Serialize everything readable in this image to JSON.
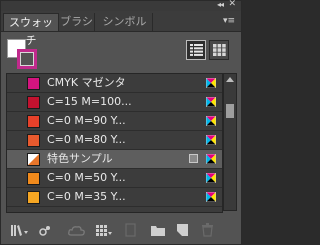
{
  "header": {
    "collapse_glyph": "◂◂",
    "close_glyph": "✕"
  },
  "tabs": [
    {
      "label": "スウォッチ",
      "active": true
    },
    {
      "label": "ブラシ",
      "active": false
    },
    {
      "label": "シンボル",
      "active": false
    }
  ],
  "panel_menu_glyph": "▾≡",
  "fill_stroke": {
    "fill_color": "#ffffff",
    "stroke_color": "#c02a8c"
  },
  "swatches": [
    {
      "label": "CMYK マゼンタ",
      "color": "#d4147f",
      "selected": false,
      "global": false
    },
    {
      "label": "C=15 M=100...",
      "color": "#c2122f",
      "selected": false,
      "global": false
    },
    {
      "label": "C=0 M=90 Y...",
      "color": "#e6412a",
      "selected": false,
      "global": false
    },
    {
      "label": "C=0 M=80 Y...",
      "color": "#e85a2e",
      "selected": false,
      "global": false
    },
    {
      "label": "特色サンプル",
      "color": "#e8762b",
      "selected": true,
      "global": true
    },
    {
      "label": "C=0 M=50 Y...",
      "color": "#f08a1c",
      "selected": false,
      "global": false
    },
    {
      "label": "C=0 M=35 Y...",
      "color": "#f5a623",
      "selected": false,
      "global": false
    }
  ],
  "icons": {
    "cmyk_mode": "cmyk-process-icon",
    "spot": "spot-color-icon",
    "list_view": "list-view-icon",
    "thumb_view": "thumbnail-view-icon",
    "library": "swatch-library-icon",
    "show_kinds": "show-swatch-kinds-icon",
    "cloud": "cloud-library-icon",
    "options": "swatch-options-icon",
    "group": "new-color-group-icon",
    "new": "new-swatch-icon",
    "delete": "delete-swatch-icon"
  }
}
